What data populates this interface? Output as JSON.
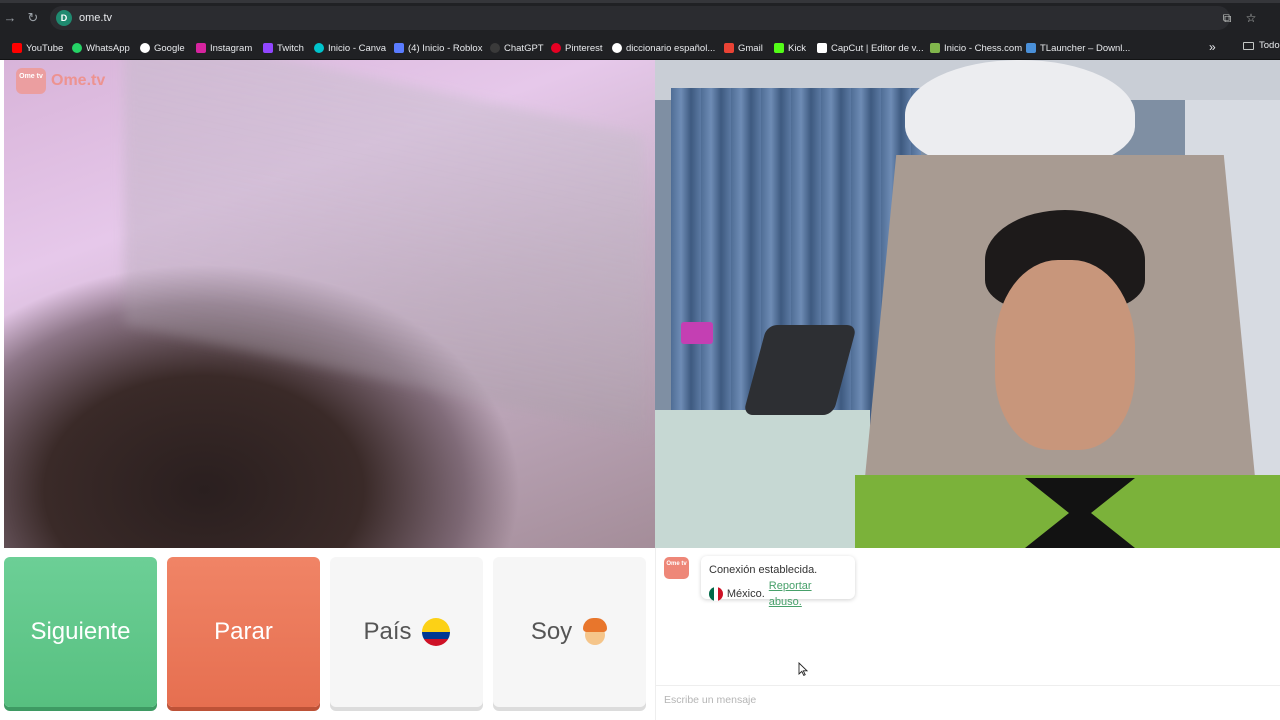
{
  "browser": {
    "url": "ome.tv",
    "bookmarks": [
      {
        "label": "YouTube",
        "color": "#ff0000"
      },
      {
        "label": "WhatsApp",
        "color": "#25d366"
      },
      {
        "label": "Google",
        "color": "#ffffff"
      },
      {
        "label": "Instagram",
        "color": "#d6249f"
      },
      {
        "label": "Twitch",
        "color": "#9146ff"
      },
      {
        "label": "Inicio - Canva",
        "color": "#00c4cc"
      },
      {
        "label": "(4) Inicio - Roblox",
        "color": "#5a7cff"
      },
      {
        "label": "ChatGPT",
        "color": "#000000"
      },
      {
        "label": "Pinterest",
        "color": "#e60023"
      },
      {
        "label": "diccionario español...",
        "color": "#ffffff"
      },
      {
        "label": "Gmail",
        "color": "#ea4335"
      },
      {
        "label": "Kick",
        "color": "#53fc18"
      },
      {
        "label": "CapCut | Editor de v...",
        "color": "#ffffff"
      },
      {
        "label": "Inicio - Chess.com",
        "color": "#81b64c"
      },
      {
        "label": "TLauncher – Downl...",
        "color": "#4a90d9"
      }
    ],
    "bookmarks_folder": "Todo"
  },
  "site": {
    "logo_badge": "Ome tv",
    "logo_text": "Ome.tv"
  },
  "controls": {
    "next_label": "Siguiente",
    "stop_label": "Parar",
    "country_label": "País",
    "gender_label": "Soy"
  },
  "chat": {
    "avatar_text": "Ome tv",
    "status_message": "Conexión establecida.",
    "partner_country": "México.",
    "report_link": "Reportar abuso.",
    "input_placeholder": "Escribe un mensaje"
  },
  "colors": {
    "next_button": "#5cc687",
    "stop_button": "#ea7658",
    "link_green": "#47a06a"
  }
}
